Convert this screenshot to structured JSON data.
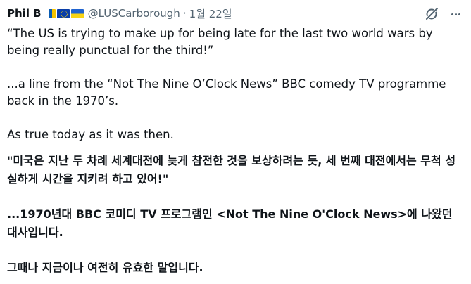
{
  "header": {
    "display_name": "Phil B",
    "flags": [
      "canary-islands-flag",
      "eu-flag",
      "ukraine-flag"
    ],
    "handle": "@LUSCarborough",
    "separator": "·",
    "date": "1월 22일"
  },
  "tweet": {
    "line_1": "“The US is trying to make up for being late for the last two world wars by being really punctual for the third!”",
    "line_2": "...a line from the “Not The Nine O’Clock News” BBC comedy TV programme back in the 1970’s.",
    "line_3": "As true today as it was then."
  },
  "translation": {
    "para_1": "\"미국은 지난 두 차례 세계대전에 늦게 참전한 것을 보상하려는 듯, 세 번째 대전에서는 무척 성실하게 시간을 지키려 하고 있어!\"",
    "para_2": "...1970년대 BBC 코미디 TV 프로그램인 <Not The Nine O'Clock News>에 나왔던 대사입니다.",
    "para_3": "그때나 지금이나 여전히 유효한 말입니다."
  },
  "icons": {
    "grok": "grok-icon",
    "more": "more-icon"
  },
  "colors": {
    "text": "#0f1419",
    "secondary": "#536471"
  }
}
